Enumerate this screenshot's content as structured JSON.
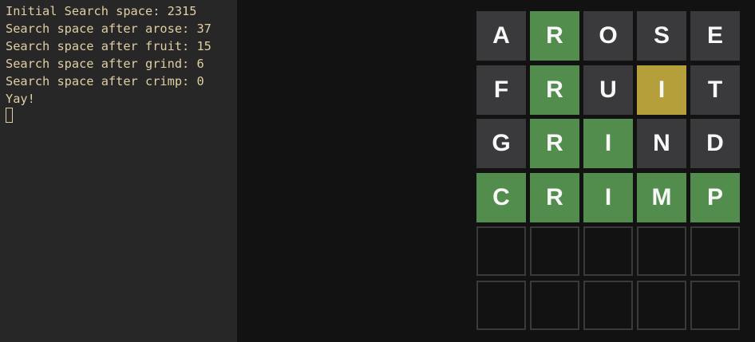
{
  "terminal": {
    "lines": [
      "Initial Search space: 2315",
      "Search space after arose: 37",
      "Search space after fruit: 15",
      "Search space after grind: 6",
      "Search space after crimp: 0",
      "Yay!"
    ]
  },
  "board": {
    "rows": [
      [
        {
          "letter": "A",
          "state": "absent"
        },
        {
          "letter": "R",
          "state": "correct"
        },
        {
          "letter": "O",
          "state": "absent"
        },
        {
          "letter": "S",
          "state": "absent"
        },
        {
          "letter": "E",
          "state": "absent"
        }
      ],
      [
        {
          "letter": "F",
          "state": "absent"
        },
        {
          "letter": "R",
          "state": "correct"
        },
        {
          "letter": "U",
          "state": "absent"
        },
        {
          "letter": "I",
          "state": "present"
        },
        {
          "letter": "T",
          "state": "absent"
        }
      ],
      [
        {
          "letter": "G",
          "state": "absent"
        },
        {
          "letter": "R",
          "state": "correct"
        },
        {
          "letter": "I",
          "state": "correct"
        },
        {
          "letter": "N",
          "state": "absent"
        },
        {
          "letter": "D",
          "state": "absent"
        }
      ],
      [
        {
          "letter": "C",
          "state": "correct"
        },
        {
          "letter": "R",
          "state": "correct"
        },
        {
          "letter": "I",
          "state": "correct"
        },
        {
          "letter": "M",
          "state": "correct"
        },
        {
          "letter": "P",
          "state": "correct"
        }
      ],
      [
        {
          "letter": "",
          "state": "empty"
        },
        {
          "letter": "",
          "state": "empty"
        },
        {
          "letter": "",
          "state": "empty"
        },
        {
          "letter": "",
          "state": "empty"
        },
        {
          "letter": "",
          "state": "empty"
        }
      ],
      [
        {
          "letter": "",
          "state": "empty"
        },
        {
          "letter": "",
          "state": "empty"
        },
        {
          "letter": "",
          "state": "empty"
        },
        {
          "letter": "",
          "state": "empty"
        },
        {
          "letter": "",
          "state": "empty"
        }
      ]
    ]
  },
  "colors": {
    "absent": "#3a3a3c",
    "correct": "#538d4e",
    "present": "#b59f3b",
    "terminal_text": "#e1cfa3"
  }
}
